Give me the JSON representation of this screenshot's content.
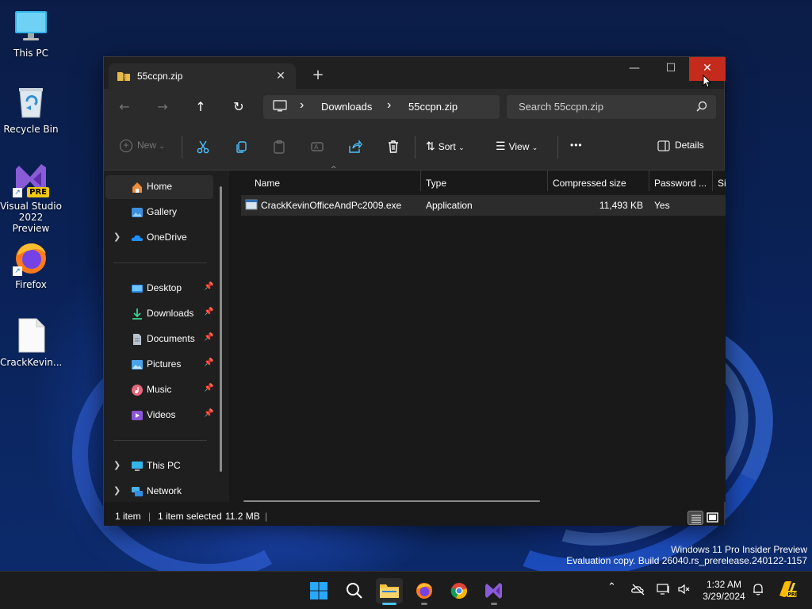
{
  "desktop": {
    "icons": [
      {
        "label": "This PC"
      },
      {
        "label": "Recycle Bin"
      },
      {
        "label": "Visual Studio 2022 Preview",
        "badge": "PRE"
      },
      {
        "label": "Firefox"
      },
      {
        "label": "CrackKevin..."
      }
    ],
    "watermark_line1": "Windows 11 Pro Insider Preview",
    "watermark_line2": "Evaluation copy. Build 26040.rs_prerelease.240122-1157"
  },
  "window": {
    "tab_title": "55ccpn.zip",
    "tab_close": "✕",
    "new_tab": "+",
    "minimize": "—",
    "maximize": "☐",
    "close": "✕",
    "nav": {
      "back": "←",
      "forward": "→",
      "up": "↑",
      "refresh": "↻"
    },
    "breadcrumb": [
      "Downloads",
      "55ccpn.zip"
    ],
    "breadcrumb_sep": "›",
    "search_placeholder": "Search 55ccpn.zip",
    "toolbar": {
      "new": "New",
      "sort": "Sort",
      "view": "View",
      "more": "•••",
      "details": "Details"
    },
    "sidebar": {
      "home": "Home",
      "gallery": "Gallery",
      "onedrive": "OneDrive",
      "pinned": [
        {
          "label": "Desktop"
        },
        {
          "label": "Downloads"
        },
        {
          "label": "Documents"
        },
        {
          "label": "Pictures"
        },
        {
          "label": "Music"
        },
        {
          "label": "Videos"
        }
      ],
      "this_pc": "This PC",
      "network": "Network"
    },
    "columns": [
      "Name",
      "Type",
      "Compressed size",
      "Password ...",
      "Si"
    ],
    "files": [
      {
        "name": "CrackKevinOfficeAndPc2009.exe",
        "type": "Application",
        "compressed_size": "11,493 KB",
        "password": "Yes"
      }
    ],
    "status": {
      "count": "1 item",
      "selected": "1 item selected",
      "size": "11.2 MB"
    }
  },
  "taskbar": {
    "clock_time": "1:32 AM",
    "clock_date": "3/29/2024",
    "tray_chevron": "⌃"
  },
  "colors": {
    "accent": "#4cc2ff",
    "close_red": "#c42b1c",
    "window_bg": "#191919",
    "toolbar_bg": "#2b2b2b"
  }
}
